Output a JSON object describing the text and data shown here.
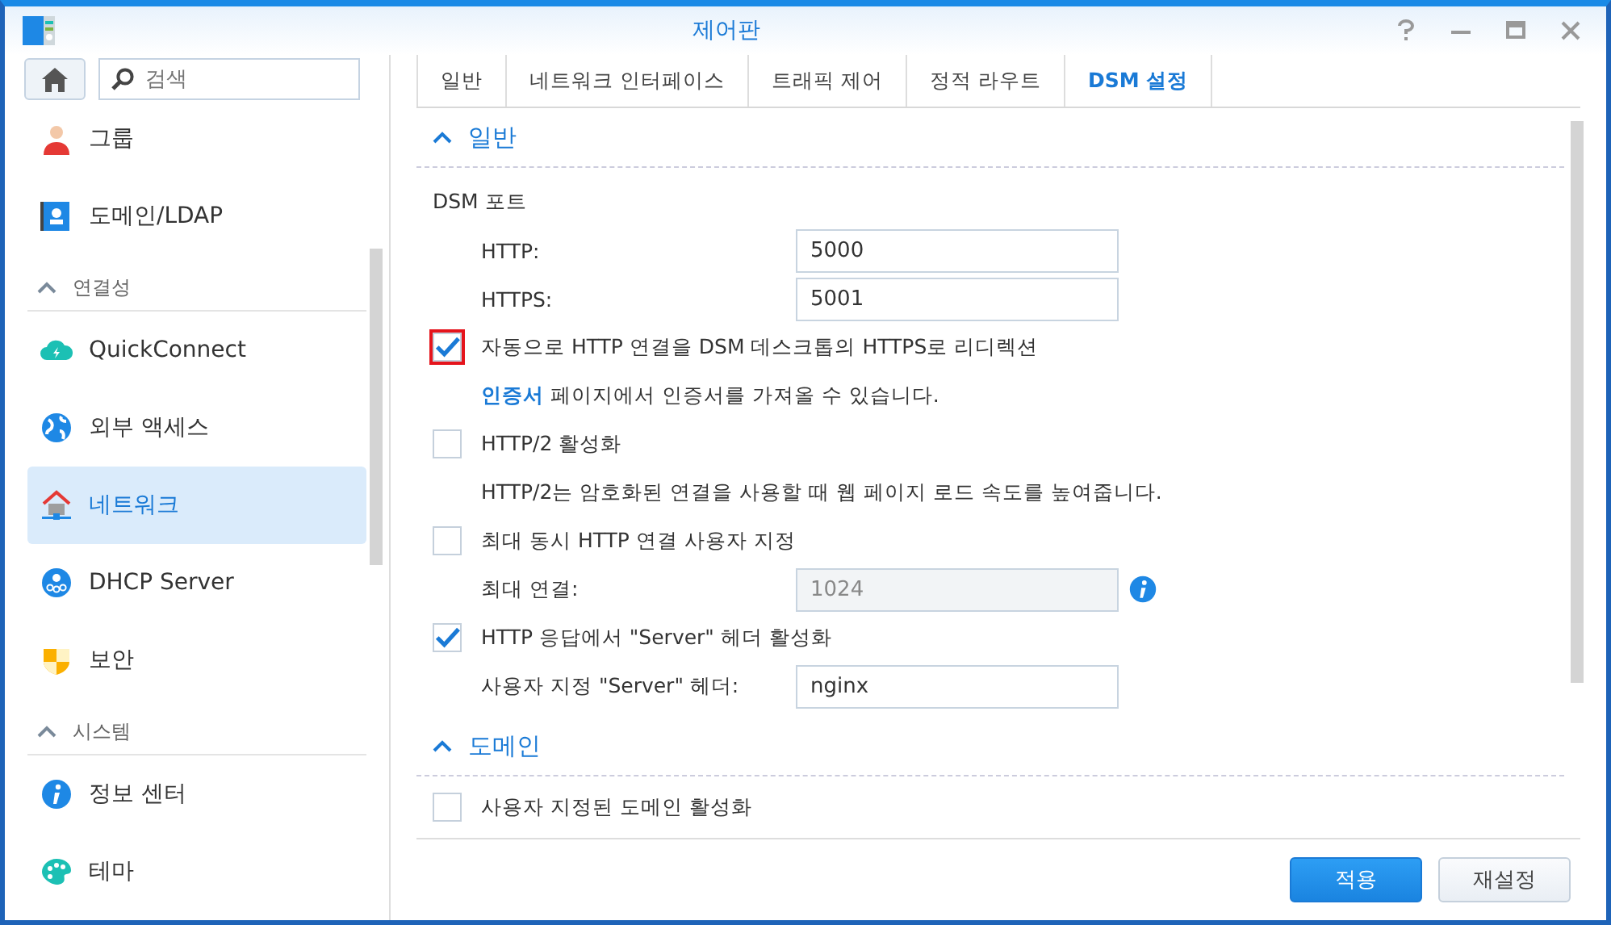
{
  "window": {
    "title": "제어판"
  },
  "search": {
    "placeholder": "검색"
  },
  "sidebar": {
    "items": [
      {
        "kind": "item",
        "label": "그룹",
        "selected": false
      },
      {
        "kind": "item",
        "label": "도메인/LDAP",
        "selected": false
      },
      {
        "kind": "header",
        "label": "연결성",
        "expanded": true
      },
      {
        "kind": "item",
        "label": "QuickConnect",
        "selected": false
      },
      {
        "kind": "item",
        "label": "외부 액세스",
        "selected": false
      },
      {
        "kind": "item",
        "label": "네트워크",
        "selected": true
      },
      {
        "kind": "item",
        "label": "DHCP Server",
        "selected": false
      },
      {
        "kind": "item",
        "label": "보안",
        "selected": false
      },
      {
        "kind": "header",
        "label": "시스템",
        "expanded": true
      },
      {
        "kind": "item",
        "label": "정보 센터",
        "selected": false
      },
      {
        "kind": "item",
        "label": "테마",
        "selected": false
      }
    ]
  },
  "tabs": [
    {
      "label": "일반",
      "selected": false
    },
    {
      "label": "네트워크 인터페이스",
      "selected": false
    },
    {
      "label": "트래픽 제어",
      "selected": false
    },
    {
      "label": "정적 라우트",
      "selected": false
    },
    {
      "label": "DSM 설정",
      "selected": true
    }
  ],
  "sections": [
    {
      "title": "일반",
      "expanded": true,
      "rows": [
        {
          "kind": "heading",
          "label": "DSM 포트"
        },
        {
          "kind": "field",
          "label": "HTTP:",
          "value": "5000",
          "disabled": false,
          "info": false
        },
        {
          "kind": "field",
          "label": "HTTPS:",
          "value": "5001",
          "disabled": false,
          "info": false
        },
        {
          "kind": "checkbox",
          "label": "자동으로 HTTP 연결을 DSM 데스크톱의 HTTPS로 리디렉션",
          "checked": true,
          "highlighted": true
        },
        {
          "kind": "note",
          "link": "인증서",
          "label": "페이지에서 인증서를 가져올 수 있습니다."
        },
        {
          "kind": "checkbox",
          "label": "HTTP/2 활성화",
          "checked": false,
          "highlighted": false
        },
        {
          "kind": "note",
          "label": "HTTP/2는 암호화된 연결을 사용할 때 웹 페이지 로드 속도를 높여줍니다."
        },
        {
          "kind": "checkbox",
          "label": "최대 동시 HTTP 연결 사용자 지정",
          "checked": false,
          "highlighted": false
        },
        {
          "kind": "field",
          "label": "최대 연결:",
          "value": "1024",
          "disabled": true,
          "info": true
        },
        {
          "kind": "checkbox",
          "label": "HTTP 응답에서 \"Server\" 헤더 활성화",
          "checked": true,
          "highlighted": false
        },
        {
          "kind": "field",
          "label": "사용자 지정 \"Server\" 헤더:",
          "value": "nginx",
          "disabled": false,
          "info": false
        }
      ]
    },
    {
      "title": "도메인",
      "expanded": true,
      "rows": [
        {
          "kind": "checkbox",
          "label": "사용자 지정된 도메인 활성화",
          "checked": false,
          "highlighted": false
        }
      ]
    }
  ],
  "buttons": [
    {
      "label": "적용",
      "kind": "primary"
    },
    {
      "label": "재설정",
      "kind": "secondary"
    }
  ]
}
